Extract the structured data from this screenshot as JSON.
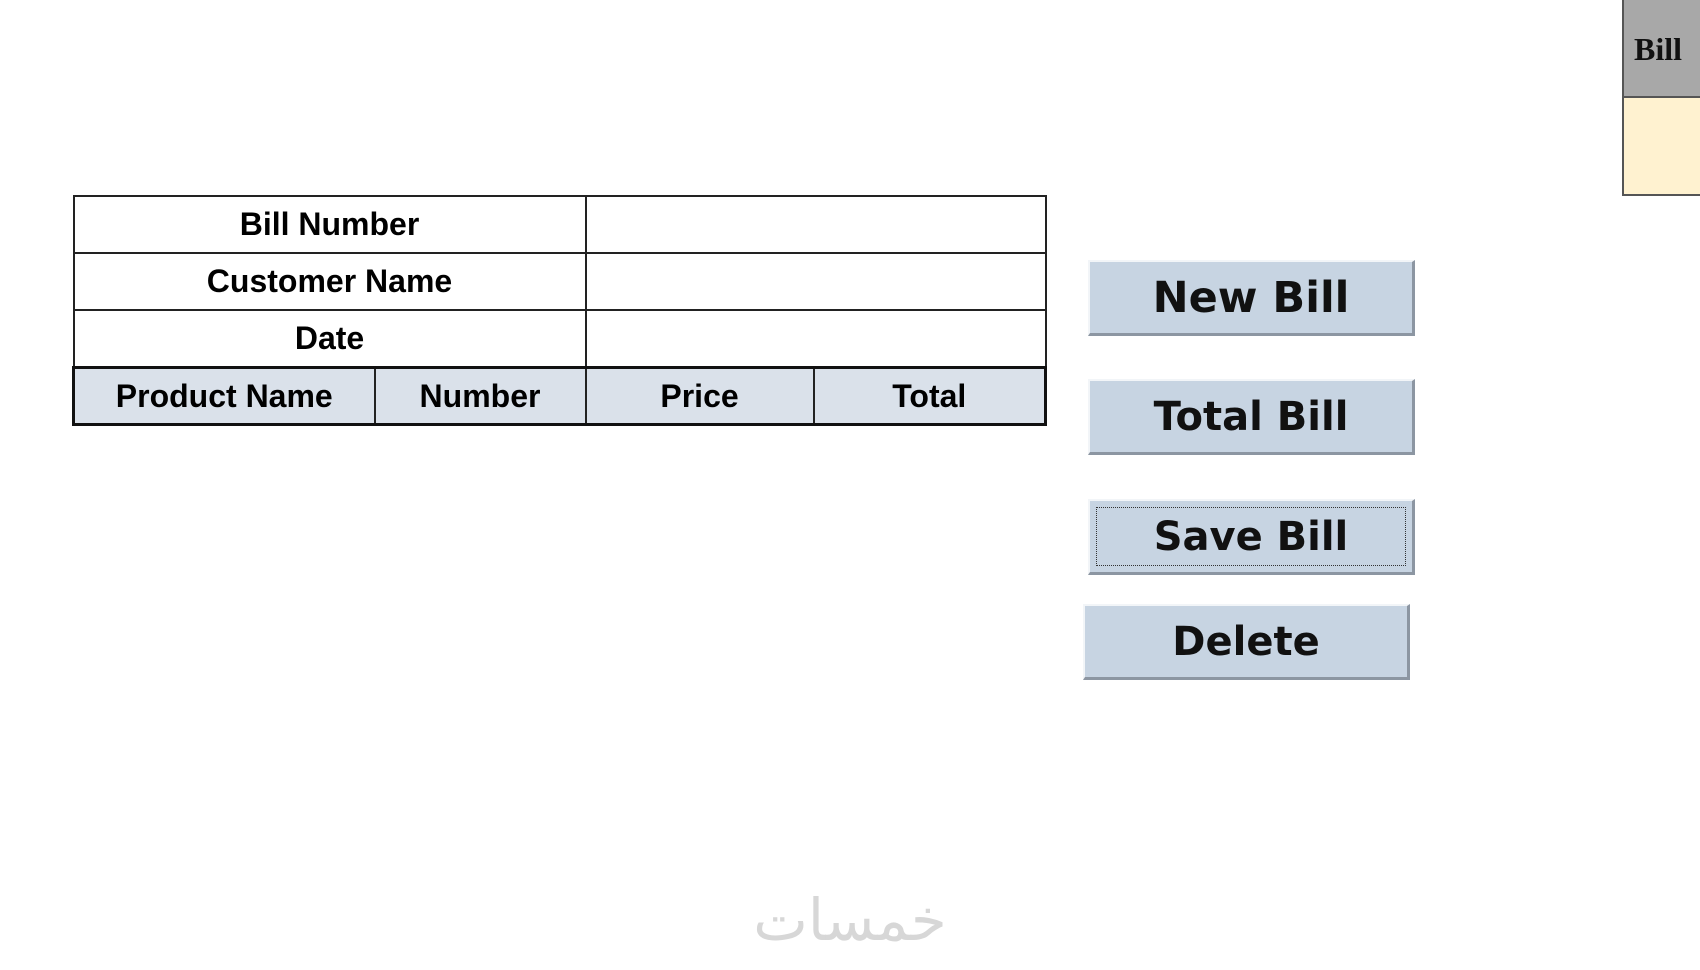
{
  "side_panel": {
    "header_label": "Bill"
  },
  "bill_form": {
    "fields": [
      {
        "label": "Bill Number",
        "value": ""
      },
      {
        "label": "Customer Name",
        "value": ""
      },
      {
        "label": "Date",
        "value": ""
      }
    ],
    "columns": [
      "Product Name",
      "Number",
      "Price",
      "Total"
    ]
  },
  "buttons": {
    "new_bill": "New Bill",
    "total_bill": "Total Bill",
    "save_bill": "Save Bill",
    "delete": "Delete"
  },
  "watermark": {
    "text": "خمسات"
  },
  "colors": {
    "button_fill": "#c7d4e2",
    "header_fill": "#dae1ea",
    "side_header_fill": "#a8a8a8",
    "side_body_fill": "#fff2d0"
  }
}
